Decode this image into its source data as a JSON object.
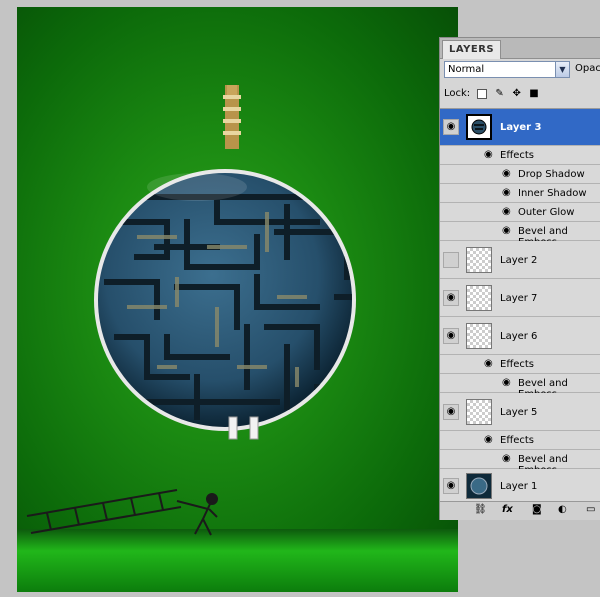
{
  "panel": {
    "tab": "LAYERS",
    "blend_mode": "Normal",
    "opacity_label": "Opac",
    "lock_label": "Lock:"
  },
  "layers": [
    {
      "name": "Layer 3",
      "visible": true,
      "selected": true,
      "effects_label": "Effects",
      "effects": [
        "Drop Shadow",
        "Inner Shadow",
        "Outer Glow",
        "Bevel and Emboss"
      ]
    },
    {
      "name": "Layer 2",
      "visible": false
    },
    {
      "name": "Layer 7",
      "visible": true
    },
    {
      "name": "Layer 6",
      "visible": true,
      "effects_label": "Effects",
      "effects": [
        "Bevel and Emboss"
      ]
    },
    {
      "name": "Layer 5",
      "visible": true,
      "effects_label": "Effects",
      "effects": [
        "Bevel and Emboss"
      ]
    },
    {
      "name": "Layer 1",
      "visible": true
    }
  ],
  "icons": {
    "eye": "eye-icon",
    "link": "link-layers-icon",
    "fx": "fx",
    "mask": "add-mask-icon",
    "adjust": "adjustment-layer-icon",
    "new": "new-layer-icon"
  },
  "colors": {
    "selection": "#3169c6",
    "background_green": "#1b8a12"
  }
}
